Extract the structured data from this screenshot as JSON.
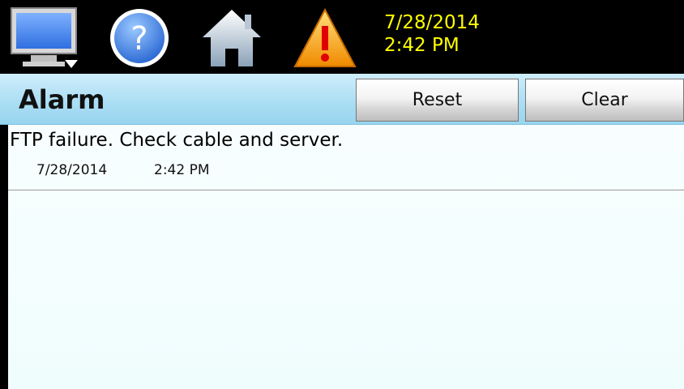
{
  "status_bar": {
    "date": "7/28/2014",
    "time": "2:42 PM",
    "accent_color": "#ffff00"
  },
  "icons": {
    "monitor": "monitor-icon",
    "help": "help-icon",
    "home": "home-icon",
    "alarm": "warning-icon"
  },
  "page": {
    "title": "Alarm",
    "reset_label": "Reset",
    "clear_label": "Clear"
  },
  "alarms": [
    {
      "message": "FTP failure. Check cable and server.",
      "date": "7/28/2014",
      "time": "2:42 PM"
    }
  ]
}
